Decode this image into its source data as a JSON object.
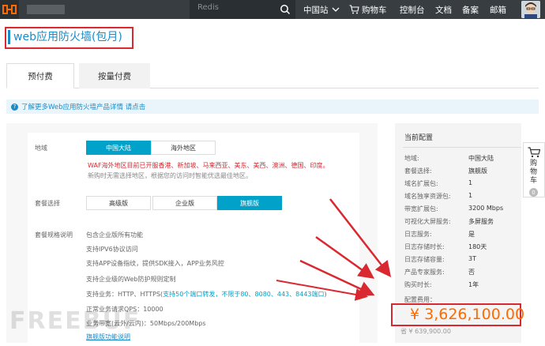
{
  "topbar": {
    "search_placeholder": "Redis",
    "nav": [
      "中国站",
      "购物车",
      "控制台",
      "文档",
      "备案",
      "邮箱"
    ]
  },
  "page": {
    "title": "web应用防火墙(包月)",
    "tabs": [
      "预付费",
      "按量付费"
    ],
    "info_text": "了解更多Web应用防火墙产品详情 请点击"
  },
  "form": {
    "region_label": "地域",
    "region_options": [
      "中国大陆",
      "海外地区"
    ],
    "region_note_red": "WAF海外地区目前已开服香港、新加坡、马来西亚、美东、美西、澳洲、德国、印度。",
    "region_note_gray": "新购时无需选择地区，根据您的访问时智能优选最佳地区。",
    "package_label": "套餐选择",
    "package_options": [
      "高级版",
      "企业版",
      "旗舰版"
    ],
    "spec_label": "套餐规格说明",
    "spec_items": [
      "包含企业版所有功能",
      "支持IPV6协议访问",
      "支持APP设备指纹，提供SDK接入，APP业务风控",
      "支持企业级的Web防护规则定制",
      "正常业务请求QPS：10000",
      "业务带宽(云外/云内)：50Mbps/200Mbps"
    ],
    "spec_ports_prefix": "支持业务：HTTP、HTTPS(",
    "spec_ports_highlight": "支持50个端口转发，不限于80、8080、443、8443端口",
    "spec_ports_suffix": ")",
    "spec_link": "旗舰版功能说明"
  },
  "config": {
    "title": "当前配置",
    "rows": [
      {
        "k": "地域:",
        "v": "中国大陆"
      },
      {
        "k": "套餐选择:",
        "v": "旗舰版"
      },
      {
        "k": "域名扩展包:",
        "v": "1"
      },
      {
        "k": "域名独享资源包:",
        "v": "1"
      },
      {
        "k": "带宽扩展包:",
        "v": "3200 Mbps"
      },
      {
        "k": "可视化大屏服务:",
        "v": "多屏服务"
      },
      {
        "k": "日志服务:",
        "v": "是"
      },
      {
        "k": "日志存储时长:",
        "v": "180天"
      },
      {
        "k": "日志存储容量:",
        "v": "3T"
      },
      {
        "k": "产品专家服务:",
        "v": "否"
      },
      {
        "k": "购买时长:",
        "v": "1年"
      }
    ],
    "price_label": "配置费用：",
    "price": "¥ 3,626,100.00",
    "original_price": "省 ¥ 639,900.00"
  },
  "cart": {
    "label": "购物车",
    "count": "0"
  },
  "watermark": "FREEBUF",
  "colors": {
    "accent": "#00a2ca",
    "alert": "#d9282f",
    "price": "#ff6a00",
    "topbar": "#373d41"
  }
}
